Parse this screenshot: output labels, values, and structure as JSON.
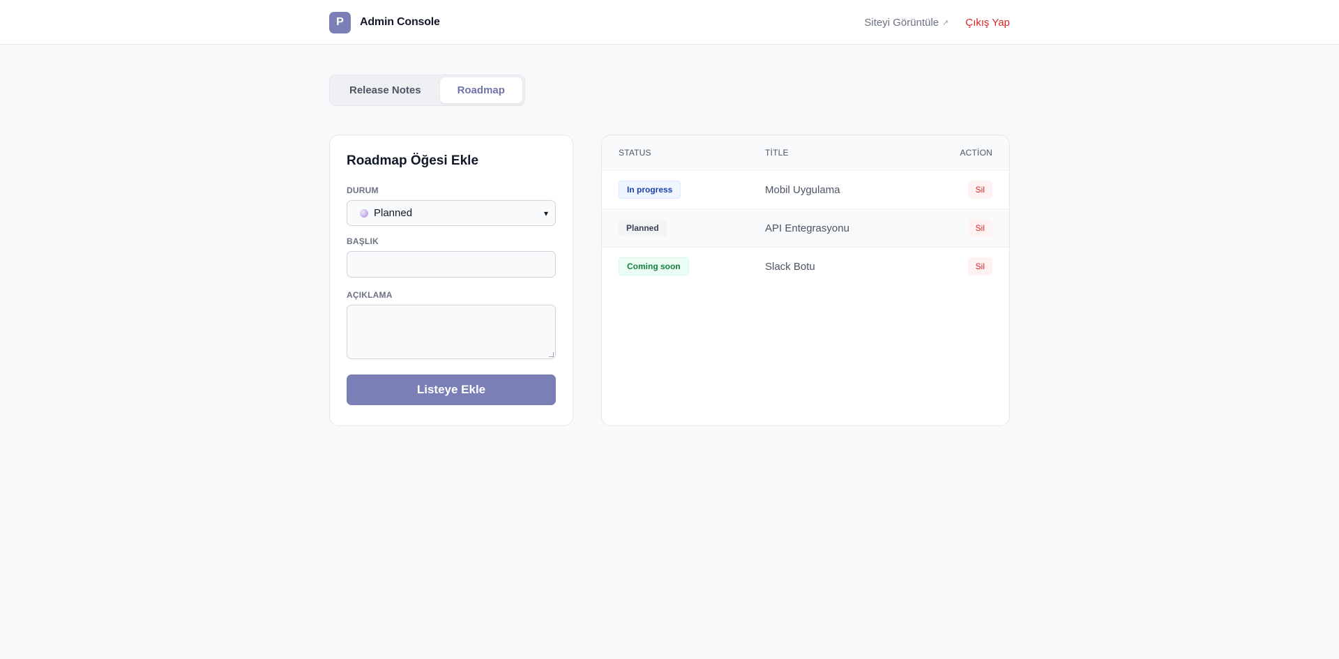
{
  "header": {
    "logo_letter": "P",
    "app_name": "Admin Console",
    "view_site_label": "Siteyi Görüntüle",
    "view_site_icon": "↗",
    "logout_label": "Çıkış Yap"
  },
  "tabs": [
    {
      "label": "Release Notes",
      "active": false
    },
    {
      "label": "Roadmap",
      "active": true
    }
  ],
  "form": {
    "title": "Roadmap Öğesi Ekle",
    "status_label": "DURUM",
    "status_value": "Planned",
    "title_label": "BAŞLIK",
    "title_value": "",
    "description_label": "AÇIKLAMA",
    "description_value": "",
    "submit_label": "Listeye Ekle"
  },
  "table": {
    "headers": [
      "STATUS",
      "TİTLE",
      "ACTİON"
    ],
    "rows": [
      {
        "status": "In progress",
        "status_color": "blue",
        "title": "Mobil Uygulama",
        "action": "Sil"
      },
      {
        "status": "Planned",
        "status_color": "gray",
        "title": "API Entegrasyonu",
        "action": "Sil"
      },
      {
        "status": "Coming soon",
        "status_color": "green",
        "title": "Slack Botu",
        "action": "Sil"
      }
    ]
  },
  "colors": {
    "accent": "#7a7fb5",
    "danger": "#dc2626"
  }
}
